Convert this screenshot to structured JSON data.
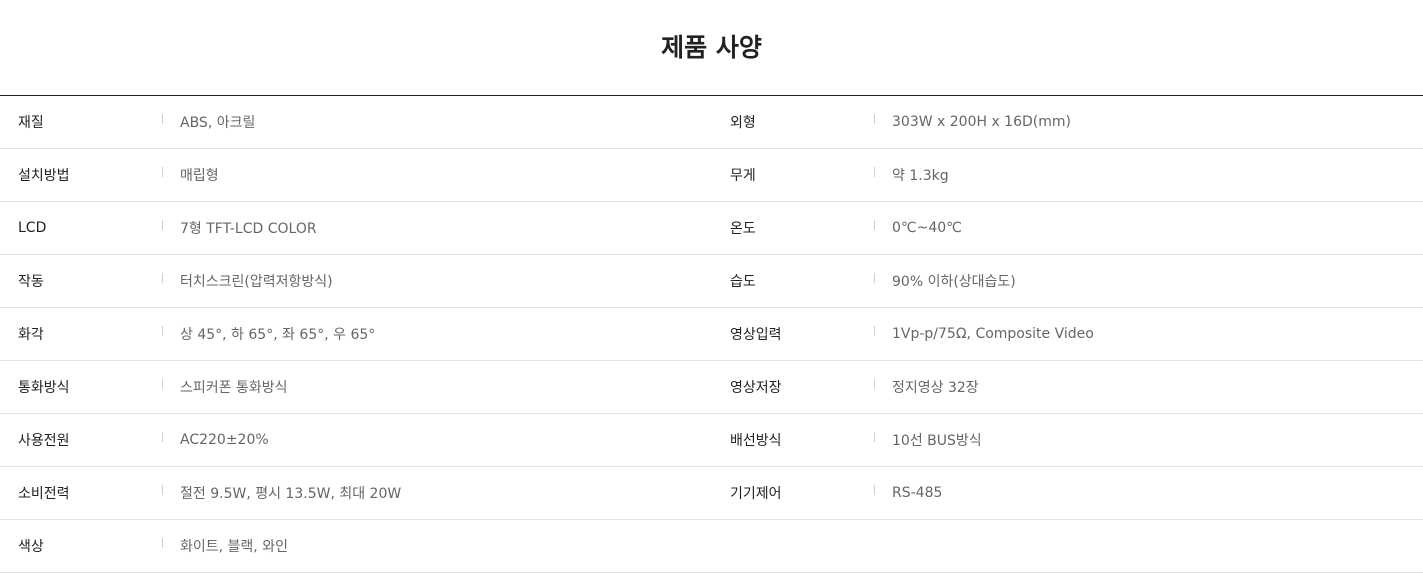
{
  "title": "제품 사양",
  "specs": [
    {
      "left": {
        "label": "재질",
        "value": "ABS, 아크릴"
      },
      "right": {
        "label": "외형",
        "value": "303W x 200H x 16D(mm)"
      }
    },
    {
      "left": {
        "label": "설치방법",
        "value": "매립형"
      },
      "right": {
        "label": "무게",
        "value": "약 1.3kg"
      }
    },
    {
      "left": {
        "label": "LCD",
        "value": "7형 TFT-LCD COLOR"
      },
      "right": {
        "label": "온도",
        "value": "0℃~40℃"
      }
    },
    {
      "left": {
        "label": "작동",
        "value": "터치스크린(압력저항방식)"
      },
      "right": {
        "label": "습도",
        "value": "90% 이하(상대습도)"
      }
    },
    {
      "left": {
        "label": "화각",
        "value": "상 45°, 하 65°, 좌 65°, 우 65°"
      },
      "right": {
        "label": "영상입력",
        "value": "1Vp-p/75Ω, Composite Video"
      }
    },
    {
      "left": {
        "label": "통화방식",
        "value": "스피커폰 통화방식"
      },
      "right": {
        "label": "영상저장",
        "value": "정지영상 32장"
      }
    },
    {
      "left": {
        "label": "사용전원",
        "value": "AC220±20%"
      },
      "right": {
        "label": "배선방식",
        "value": "10선 BUS방식"
      }
    },
    {
      "left": {
        "label": "소비전력",
        "value": "절전 9.5W, 평시 13.5W, 최대 20W"
      },
      "right": {
        "label": "기기제어",
        "value": "RS-485"
      }
    },
    {
      "left": {
        "label": "색상",
        "value": "화이트, 블랙, 와인"
      },
      "right": {
        "label": "",
        "value": ""
      }
    }
  ]
}
